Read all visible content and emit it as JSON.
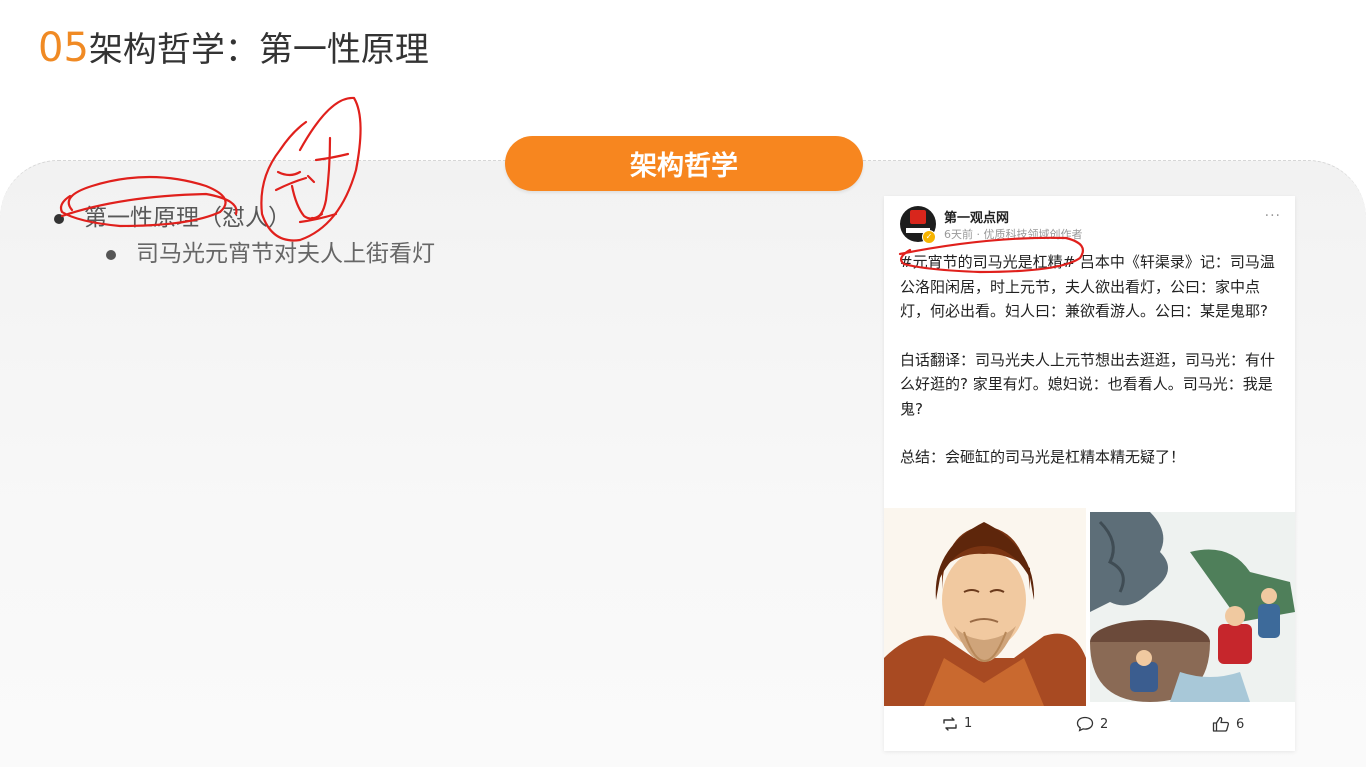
{
  "slide": {
    "title_number": "05",
    "title_text": "架构哲学：第一性原理",
    "section_pill": "架构哲学"
  },
  "bullets": {
    "level1": "第一性原理（怼人）",
    "level2": "司马光元宵节对夫人上街看灯"
  },
  "annotation": {
    "handwritten": "怼"
  },
  "post": {
    "author": "第一观点网",
    "meta": "6天前 · 优质科技领域创作者",
    "more": "···",
    "paragraphs": [
      "#元宵节的司马光是杠精# 吕本中《轩渠录》记：司马温公洛阳闲居，时上元节，夫人欲出看灯，公曰：家中点灯，何必出看。妇人曰：兼欲看游人。公曰：某是鬼耶?",
      "白话翻译：司马光夫人上元节想出去逛逛，司马光：有什么好逛的? 家里有灯。媳妇说：也看看人。司马光：我是鬼?",
      "总结：会砸缸的司马光是杠精本精无疑了！"
    ],
    "repost_count": "1",
    "comment_count": "2",
    "like_count": "6"
  },
  "colors": {
    "accent": "#f7861f",
    "title_number": "#f08a24",
    "ink": "#e0201c"
  },
  "icons": {
    "repost": "repost-icon",
    "comment": "comment-icon",
    "like": "thumbs-up-icon",
    "more": "more-icon"
  }
}
